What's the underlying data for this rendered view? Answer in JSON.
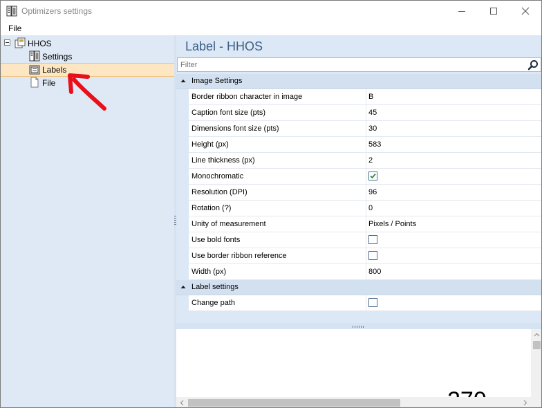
{
  "window": {
    "title": "Optimizers settings"
  },
  "menu": {
    "file": "File"
  },
  "tree": {
    "root": "HHOS",
    "items": [
      {
        "label": "Settings",
        "icon": "settings-icon"
      },
      {
        "label": "Labels",
        "icon": "label-icon",
        "selected": true
      },
      {
        "label": "File",
        "icon": "file-icon"
      }
    ]
  },
  "header": {
    "title": "Label - HHOS"
  },
  "filter": {
    "placeholder": "Filter"
  },
  "categories": [
    {
      "label": "Image Settings",
      "props": [
        {
          "name": "Border ribbon character in image",
          "value": "B"
        },
        {
          "name": "Caption font size (pts)",
          "value": "45"
        },
        {
          "name": "Dimensions font size (pts)",
          "value": "30"
        },
        {
          "name": "Height (px)",
          "value": "583"
        },
        {
          "name": "Line thickness (px)",
          "value": "2"
        },
        {
          "name": "Monochromatic",
          "value": "",
          "checkbox": true,
          "checked": true
        },
        {
          "name": "Resolution (DPI)",
          "value": "96"
        },
        {
          "name": "Rotation (?)",
          "value": "0"
        },
        {
          "name": "Unity of measurement",
          "value": "Pixels / Points"
        },
        {
          "name": "Use bold fonts",
          "value": "",
          "checkbox": true,
          "checked": false
        },
        {
          "name": "Use border ribbon reference",
          "value": "",
          "checkbox": true,
          "checked": false
        },
        {
          "name": "Width (px)",
          "value": "800"
        }
      ]
    },
    {
      "label": "Label settings",
      "props": [
        {
          "name": "Change path",
          "value": "",
          "checkbox": true,
          "checked": false
        }
      ]
    }
  ],
  "preview": {
    "partial_text": "270"
  },
  "colors": {
    "accent": "#3c5f86",
    "selection": "#fde7c3",
    "annotation_arrow": "#e8101a"
  }
}
